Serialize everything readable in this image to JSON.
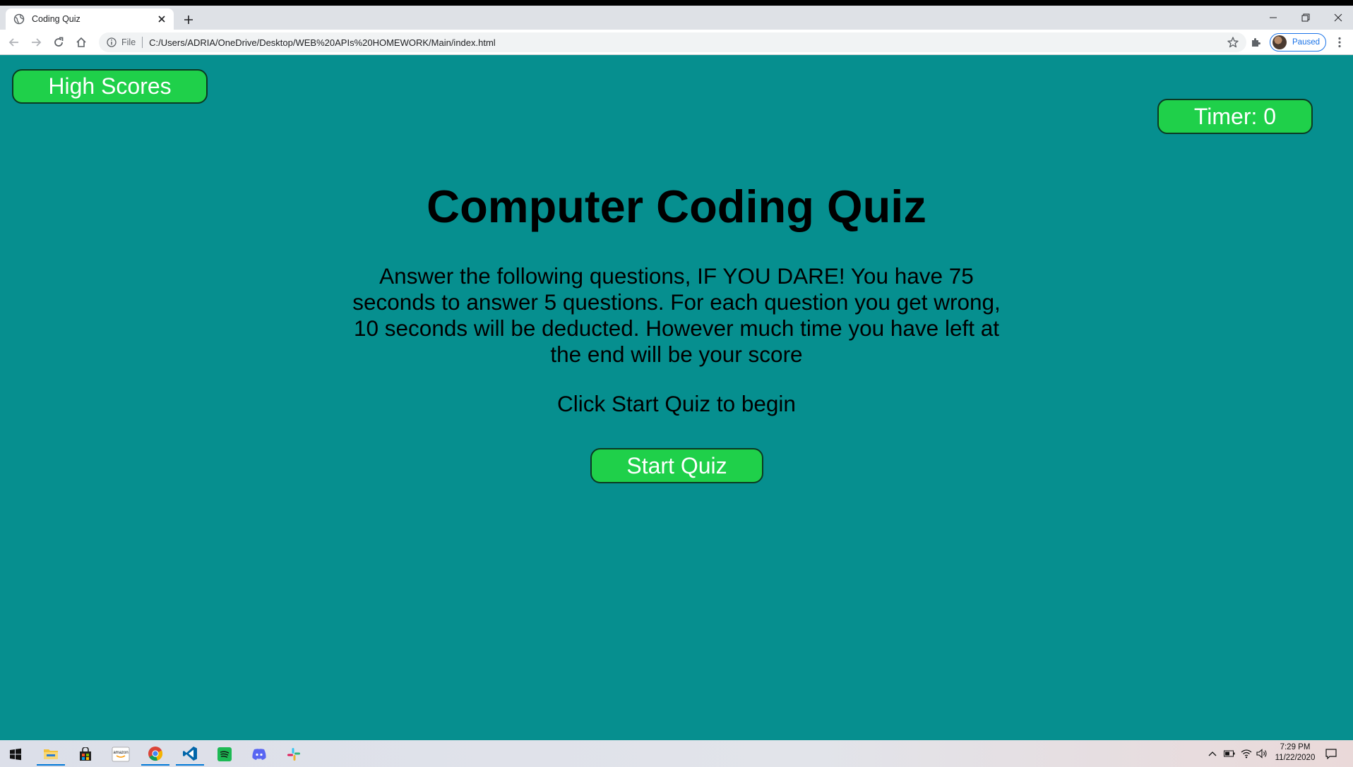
{
  "browser": {
    "tab_title": "Coding Quiz",
    "file_label": "File",
    "url": "C:/Users/ADRIA/OneDrive/Desktop/WEB%20APIs%20HOMEWORK/Main/index.html",
    "profile_status": "Paused"
  },
  "page": {
    "high_scores_label": "High Scores",
    "timer_text": "Timer: 0",
    "title": "Computer Coding Quiz",
    "description": "Answer the following questions, IF YOU DARE! You have 75 seconds to answer 5 questions. For each question you get wrong, 10 seconds will be deducted. However much time you have left at the end will be your score",
    "prompt": "Click Start Quiz to begin",
    "start_label": "Start Quiz"
  },
  "taskbar": {
    "apps": [
      "windows-start-icon",
      "file-explorer-icon",
      "store-icon",
      "amazon-icon",
      "chrome-icon",
      "vscode-icon",
      "spotify-icon",
      "discord-icon",
      "slack-icon"
    ],
    "amazon_label": "amazon",
    "time": "7:29 PM",
    "date": "11/22/2020"
  },
  "colors": {
    "page_background": "#068f8f",
    "button_green": "#1fd04a",
    "link_blue": "#1a73e8"
  }
}
